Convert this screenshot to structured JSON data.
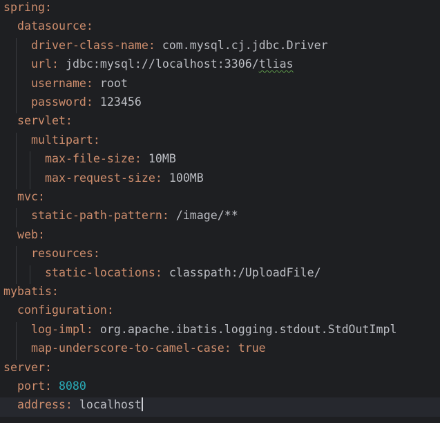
{
  "editor": {
    "language": "yaml",
    "colors": {
      "background": "#1e1f22",
      "key": "#cf8e6d",
      "string": "#bcbec4",
      "number": "#2aacb8",
      "current_line": "#26282e"
    },
    "lines": [
      {
        "indent": 0,
        "key": "spring:",
        "value": ""
      },
      {
        "indent": 2,
        "key": "datasource:",
        "value": ""
      },
      {
        "indent": 4,
        "key": "driver-class-name:",
        "value": " com.mysql.cj.jdbc.Driver"
      },
      {
        "indent": 4,
        "key": "url:",
        "value": " jdbc:mysql://localhost:3306/",
        "value2": "tlias",
        "value2_style": "squiggle"
      },
      {
        "indent": 4,
        "key": "username:",
        "value": " root"
      },
      {
        "indent": 4,
        "key": "password:",
        "value": " 123456"
      },
      {
        "indent": 2,
        "key": "servlet:",
        "value": ""
      },
      {
        "indent": 4,
        "key": "multipart:",
        "value": ""
      },
      {
        "indent": 6,
        "key": "max-file-size:",
        "value": " 10MB"
      },
      {
        "indent": 6,
        "key": "max-request-size:",
        "value": " 100MB"
      },
      {
        "indent": 2,
        "key": "mvc:",
        "value": ""
      },
      {
        "indent": 4,
        "key": "static-path-pattern:",
        "value": " /image/**"
      },
      {
        "indent": 2,
        "key": "web:",
        "value": ""
      },
      {
        "indent": 4,
        "key": "resources:",
        "value": ""
      },
      {
        "indent": 6,
        "key": "static-locations:",
        "value": " classpath:/UploadFile/"
      },
      {
        "indent": 0,
        "key": "mybatis:",
        "value": ""
      },
      {
        "indent": 2,
        "key": "configuration:",
        "value": ""
      },
      {
        "indent": 4,
        "key": "log-impl:",
        "value": " org.apache.ibatis.logging.stdout.StdOutImpl"
      },
      {
        "indent": 4,
        "key": "map-underscore-to-camel-case:",
        "value": " true",
        "type": "kw"
      },
      {
        "indent": 0,
        "key": "server:",
        "value": ""
      },
      {
        "indent": 2,
        "key": "port:",
        "value": " 8080",
        "type": "num"
      },
      {
        "indent": 2,
        "key": "address:",
        "value": " localhost",
        "current": true
      }
    ]
  }
}
